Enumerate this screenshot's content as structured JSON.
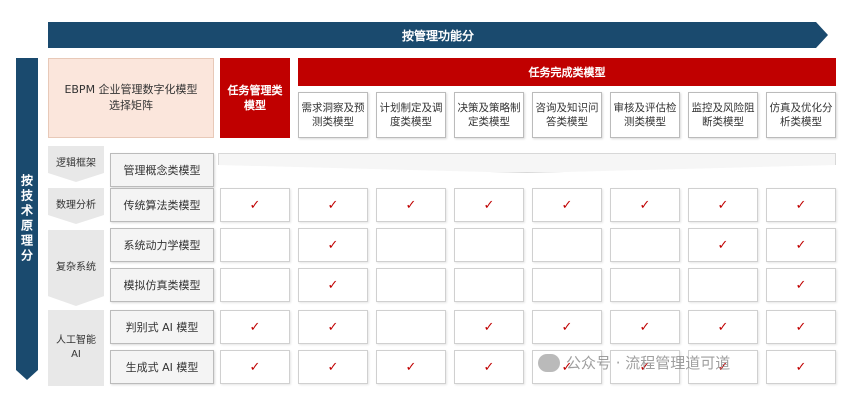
{
  "top_label": "按管理功能分",
  "side_label": "按技术原理分",
  "corner_title": "EBPM 企业管理数字化模型选择矩阵",
  "task_mgmt_header": "任务管理类模型",
  "task_complete_header": "任务完成类模型",
  "columns": [
    "需求洞察及预测类模型",
    "计划制定及调度类模型",
    "决策及策略制定类模型",
    "咨询及知识问答类模型",
    "审核及评估检测类模型",
    "监控及风险阻断类模型",
    "仿真及优化分析类模型"
  ],
  "categories": [
    "逻辑框架",
    "数理分析",
    "复杂系统",
    "人工智能AI"
  ],
  "rows": [
    "管理概念类模型",
    "传统算法类模型",
    "系统动力学模型",
    "模拟仿真类模型",
    "判别式 AI 模型",
    "生成式 AI 模型"
  ],
  "check_symbol": "✓",
  "checks": [
    [
      0,
      0,
      0,
      0,
      0,
      0,
      0,
      0
    ],
    [
      1,
      1,
      1,
      1,
      1,
      1,
      1,
      1
    ],
    [
      0,
      1,
      0,
      0,
      0,
      0,
      1,
      1
    ],
    [
      0,
      1,
      0,
      0,
      0,
      0,
      0,
      1
    ],
    [
      1,
      1,
      0,
      1,
      1,
      1,
      1,
      1
    ],
    [
      1,
      1,
      1,
      1,
      1,
      1,
      1,
      1
    ]
  ],
  "watermark": "公众号 · 流程管理道可道"
}
